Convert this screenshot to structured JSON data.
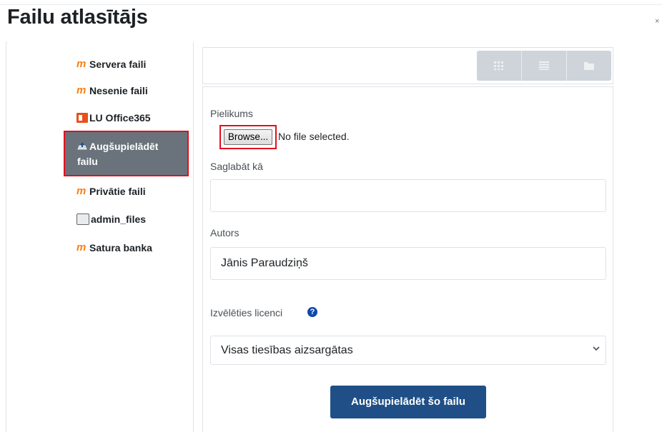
{
  "dialog": {
    "title": "Failu atlasītājs",
    "close_label": "×"
  },
  "sidebar": {
    "items": [
      {
        "label": "Servera faili",
        "icon": "moodle-icon"
      },
      {
        "label": "Nesenie faili",
        "icon": "moodle-icon"
      },
      {
        "label": "LU Office365",
        "icon": "office365-icon"
      },
      {
        "label": "Augšupielādēt failu",
        "icon": "upload-icon",
        "active": true
      },
      {
        "label": "Privātie faili",
        "icon": "moodle-icon"
      },
      {
        "label": "admin_files",
        "icon": "drive-icon"
      },
      {
        "label": "Satura banka",
        "icon": "moodle-icon"
      }
    ],
    "active_line1": "Augšupielādēt",
    "active_line2": "failu"
  },
  "toolbar": {
    "views": [
      "icons-view",
      "list-view",
      "tree-view"
    ]
  },
  "form": {
    "attachment_label": "Pielikums",
    "browse_label": "Browse...",
    "no_file_text": "No file selected.",
    "save_as_label": "Saglabāt kā",
    "save_as_value": "",
    "author_label": "Autors",
    "author_value": "Jānis Paraudziņš",
    "license_label": "Izvēlēties licenci",
    "license_value": "Visas tiesības aizsargātas",
    "submit_label": "Augšupielādēt šo failu"
  },
  "colors": {
    "active_item_bg": "#6a737b",
    "highlight_border": "#e0101f",
    "primary_button": "#1f4f86",
    "moodle_orange": "#f98012",
    "help_icon": "#0f47ad"
  }
}
